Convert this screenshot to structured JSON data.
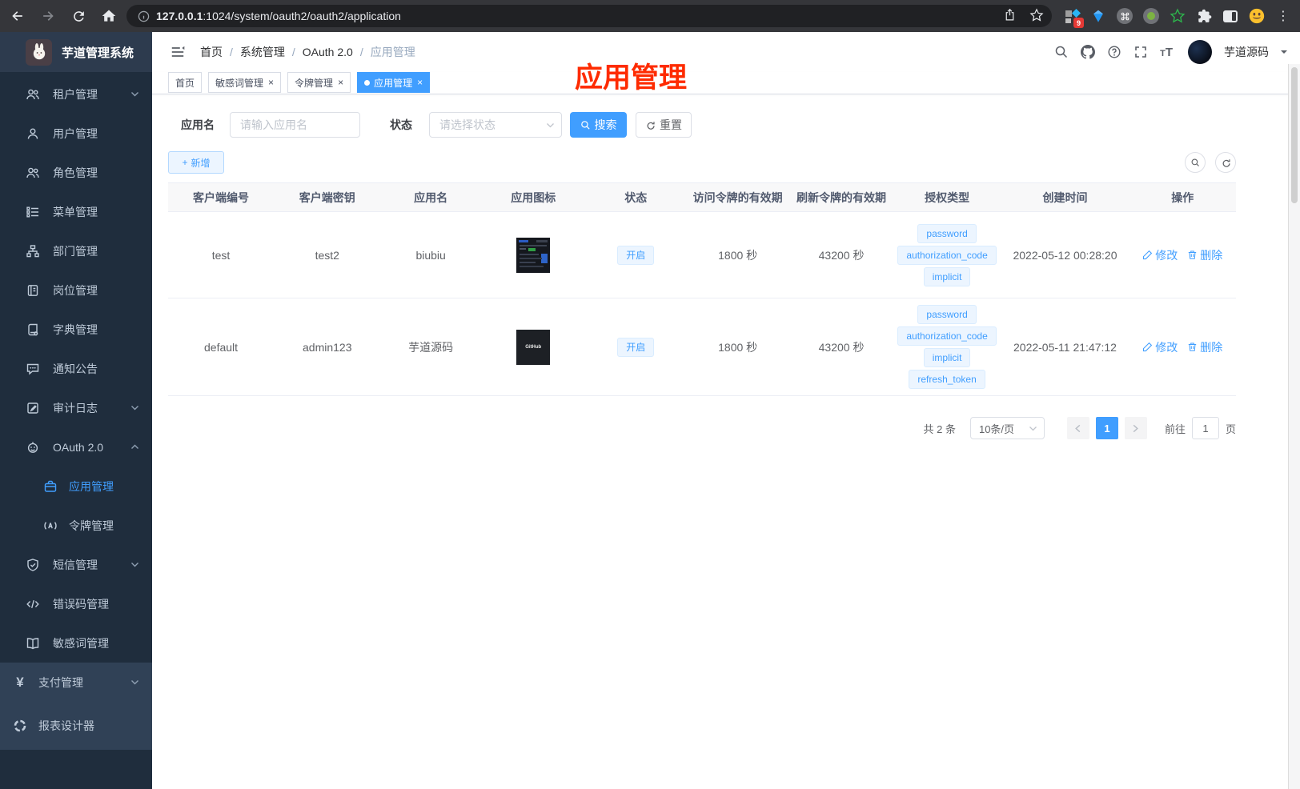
{
  "browser": {
    "url_host": "127.0.0.1",
    "url_rest": ":1024/system/oauth2/oauth2/application",
    "ext_badge": "9"
  },
  "sidebar": {
    "title": "芋道管理系统",
    "menu": [
      {
        "label": "租户管理"
      },
      {
        "label": "用户管理"
      },
      {
        "label": "角色管理"
      },
      {
        "label": "菜单管理"
      },
      {
        "label": "部门管理"
      },
      {
        "label": "岗位管理"
      },
      {
        "label": "字典管理"
      },
      {
        "label": "通知公告"
      },
      {
        "label": "审计日志"
      },
      {
        "label": "OAuth 2.0"
      },
      {
        "label": "应用管理"
      },
      {
        "label": "令牌管理"
      },
      {
        "label": "短信管理"
      },
      {
        "label": "错误码管理"
      },
      {
        "label": "敏感词管理"
      }
    ],
    "bottom": [
      {
        "label": "支付管理",
        "icon_text": "¥"
      },
      {
        "label": "报表设计器"
      }
    ]
  },
  "header": {
    "breadcrumb": [
      "首页",
      "系统管理",
      "OAuth 2.0",
      "应用管理"
    ],
    "sep": "/",
    "username": "芋道源码"
  },
  "tabs": [
    {
      "label": "首页"
    },
    {
      "label": "敏感词管理",
      "close": "×"
    },
    {
      "label": "令牌管理",
      "close": "×"
    },
    {
      "label": "应用管理",
      "close": "×"
    }
  ],
  "filters": {
    "name_label": "应用名",
    "name_placeholder": "请输入应用名",
    "status_label": "状态",
    "status_placeholder": "请选择状态",
    "search_label": "搜索",
    "reset_label": "重置"
  },
  "toolbar": {
    "add_label": "新增",
    "plus": "+"
  },
  "table": {
    "columns": [
      "客户端编号",
      "客户端密钥",
      "应用名",
      "应用图标",
      "状态",
      "访问令牌的有效期",
      "刷新令牌的有效期",
      "授权类型",
      "创建时间",
      "操作"
    ],
    "rows": [
      {
        "client_id": "test",
        "client_secret": "test2",
        "name": "biubiu",
        "status": "开启",
        "access_validity": "1800 秒",
        "refresh_validity": "43200 秒",
        "grants": [
          "password",
          "authorization_code",
          "implicit"
        ],
        "created_at": "2022-05-12 00:28:20",
        "edit_label": "修改",
        "delete_label": "删除"
      },
      {
        "client_id": "default",
        "client_secret": "admin123",
        "name": "芋道源码",
        "icon_text": "GitHub",
        "status": "开启",
        "access_validity": "1800 秒",
        "refresh_validity": "43200 秒",
        "grants": [
          "password",
          "authorization_code",
          "implicit",
          "refresh_token"
        ],
        "created_at": "2022-05-11 21:47:12",
        "edit_label": "修改",
        "delete_label": "删除"
      }
    ]
  },
  "pagination": {
    "total": "共 2 条",
    "page_size": "10条/页",
    "current_page": "1",
    "goto_label": "前往",
    "goto_value": "1",
    "page_unit": "页"
  },
  "annotation": {
    "text": "应用管理",
    "color": "#fe2b00"
  },
  "colors": {
    "accent": "#409eff",
    "sidebar_bg": "#1f2d3d",
    "sidebar_logo_bg": "#2d3b4e",
    "sidebar_bottom_bg": "#304156",
    "sidebar_text": "#bfcbd9",
    "tag_bg": "#ecf5ff",
    "tag_border": "#d9ecff"
  }
}
